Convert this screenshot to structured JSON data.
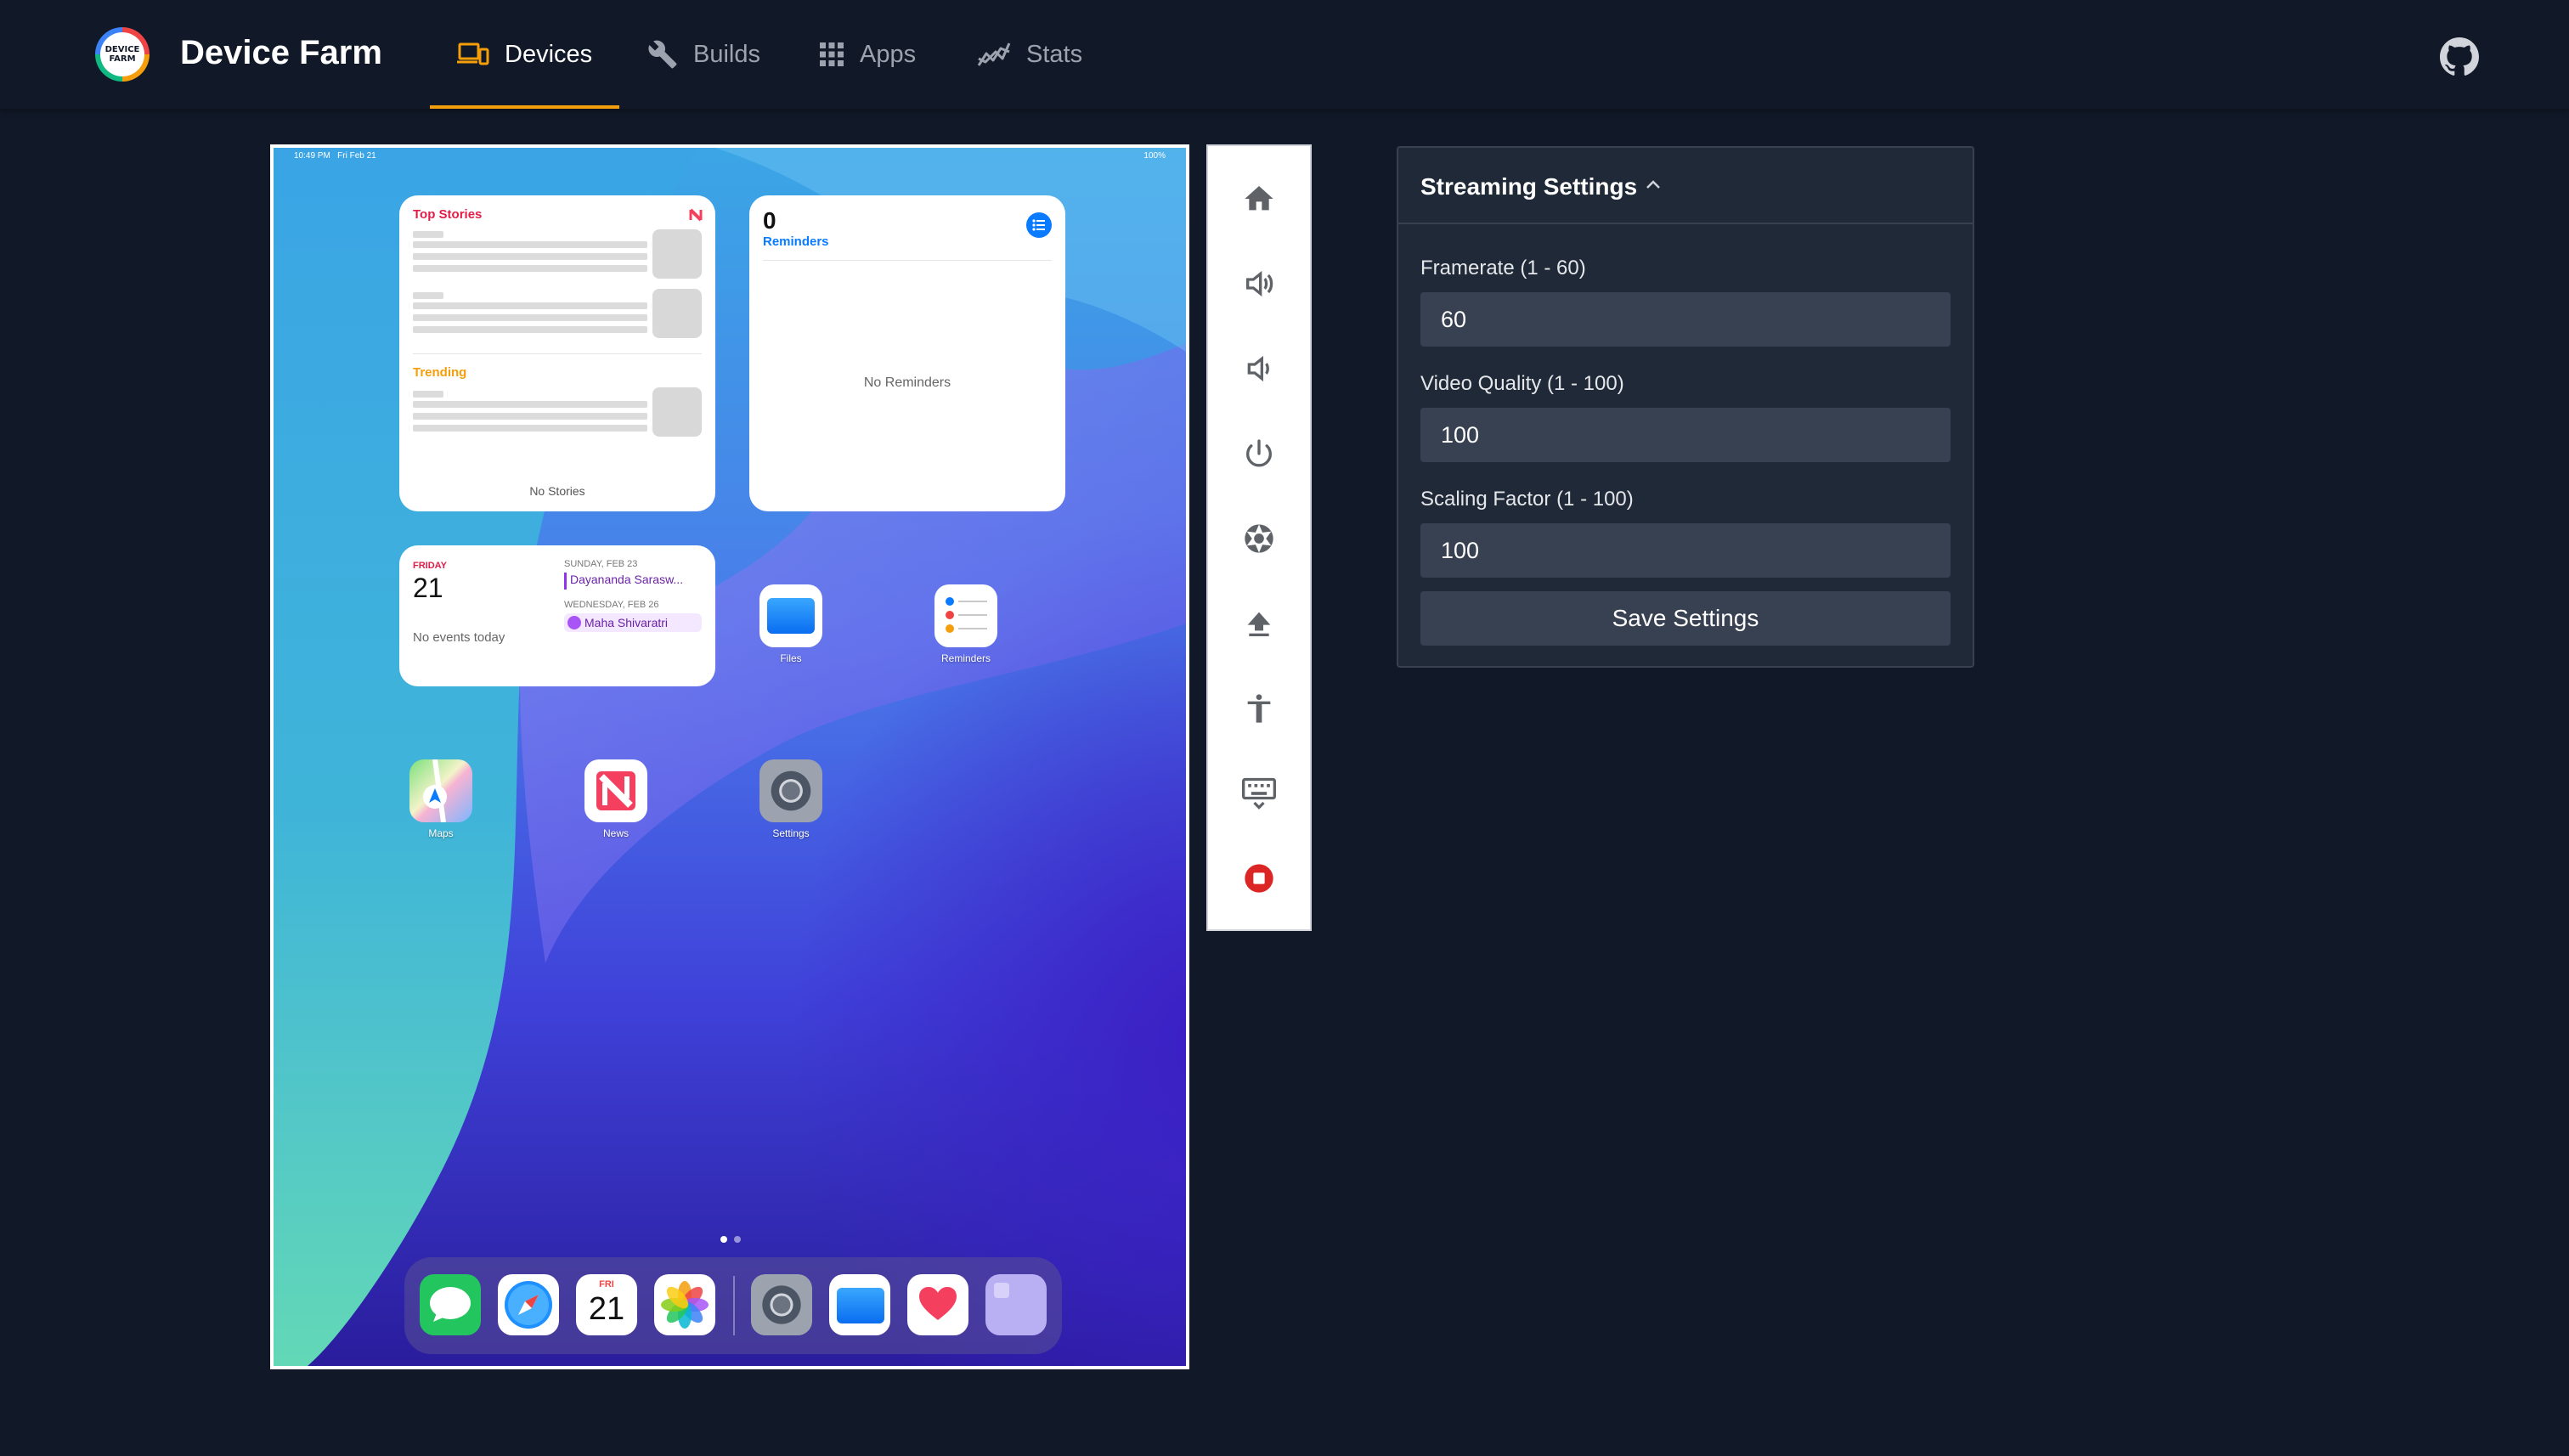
{
  "app": {
    "logo_lines": [
      "DEVICE",
      "FARM"
    ],
    "title": "Device Farm"
  },
  "nav": {
    "items": [
      {
        "label": "Devices",
        "icon": "devices-icon",
        "active": true
      },
      {
        "label": "Builds",
        "icon": "wrench-icon",
        "active": false
      },
      {
        "label": "Apps",
        "icon": "apps-grid-icon",
        "active": false
      },
      {
        "label": "Stats",
        "icon": "stats-chart-icon",
        "active": false
      }
    ],
    "github_icon": "github-icon"
  },
  "device_screen": {
    "status_time": "10:49 PM",
    "status_date": "Fri Feb 21",
    "status_battery": "100%",
    "news_widget": {
      "title": "Top Stories",
      "section": "Trending",
      "empty": "No Stories"
    },
    "reminders_widget": {
      "count": "0",
      "label": "Reminders",
      "empty": "No Reminders"
    },
    "calendar_widget": {
      "day": "FRIDAY",
      "date": "21",
      "empty": "No events today",
      "event1_header": "SUNDAY, FEB 23",
      "event1": "Dayananda Sarasw...",
      "event2_header": "WEDNESDAY, FEB 26",
      "event2": "Maha Shivaratri"
    },
    "apps": [
      {
        "label": "Files"
      },
      {
        "label": "Reminders"
      },
      {
        "label": "Maps"
      },
      {
        "label": "News"
      },
      {
        "label": "Settings"
      }
    ],
    "dock": {
      "calendar_day": "FRI",
      "calendar_date": "21"
    }
  },
  "controls": {
    "buttons": [
      {
        "name": "home-button",
        "icon": "home-icon"
      },
      {
        "name": "volume-up-button",
        "icon": "volume-up-icon"
      },
      {
        "name": "volume-down-button",
        "icon": "volume-down-icon"
      },
      {
        "name": "power-button",
        "icon": "power-icon"
      },
      {
        "name": "screenshot-button",
        "icon": "camera-shutter-icon"
      },
      {
        "name": "upload-button",
        "icon": "upload-icon"
      },
      {
        "name": "accessibility-button",
        "icon": "accessibility-icon"
      },
      {
        "name": "keyboard-button",
        "icon": "keyboard-icon"
      },
      {
        "name": "stop-session-button",
        "icon": "stop-icon"
      }
    ],
    "colors": {
      "icon": "#5f6368",
      "stop": "#dc2626"
    }
  },
  "streaming_settings": {
    "title": "Streaming Settings",
    "framerate_label": "Framerate (1 - 60)",
    "framerate_value": "60",
    "quality_label": "Video Quality (1 - 100)",
    "quality_value": "100",
    "scaling_label": "Scaling Factor (1 - 100)",
    "scaling_value": "100",
    "save_label": "Save Settings"
  },
  "colors": {
    "background": "#111827",
    "panel": "#1f2937",
    "input": "#374151",
    "accent": "#f59e0b"
  }
}
